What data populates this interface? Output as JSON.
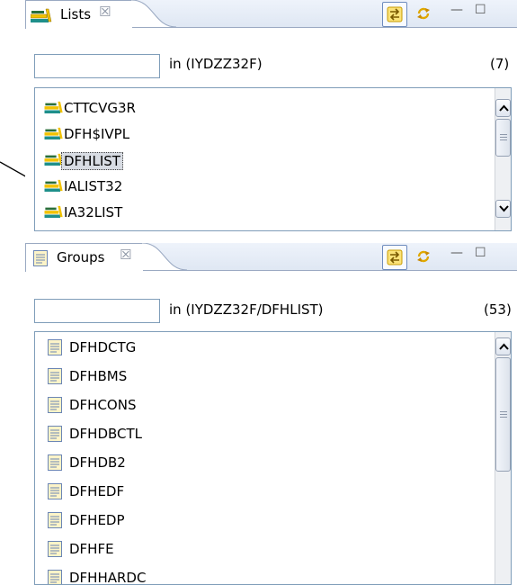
{
  "lists_view": {
    "tab_label": "Lists",
    "tab_close_glyph": "☒",
    "filter_value": "",
    "scope": "in (IYDZZ32F)",
    "count": "(7)",
    "items": [
      "CTTCVG3R",
      "DFH$IVPL",
      "DFHLIST",
      "IALIST32",
      "IA32LIST"
    ],
    "selected_item": "DFHLIST",
    "icon": "stacked-books-icon"
  },
  "groups_view": {
    "tab_label": "Groups",
    "tab_close_glyph": "☒",
    "filter_value": "",
    "scope": "in (IYDZZ32F/DFHLIST)",
    "count": "(53)",
    "items": [
      "DFHDCTG",
      "DFHBMS",
      "DFHCONS",
      "DFHDBCTL",
      "DFHDB2",
      "DFHEDF",
      "DFHEDP",
      "DFHFE",
      "DFHHARDC"
    ],
    "icon": "document-icon"
  },
  "toolbar": {
    "minimize_glyph": "—",
    "maximize_glyph": "☐",
    "link_icon": "link-with-editor-icon",
    "refresh_icon": "refresh-icon"
  },
  "colors": {
    "tab_bar": "#dfe7f3",
    "border": "#7f9db9",
    "selection": "#d8dce3",
    "icon_yellow": "#f2c200",
    "icon_teal": "#1e8f8a"
  }
}
